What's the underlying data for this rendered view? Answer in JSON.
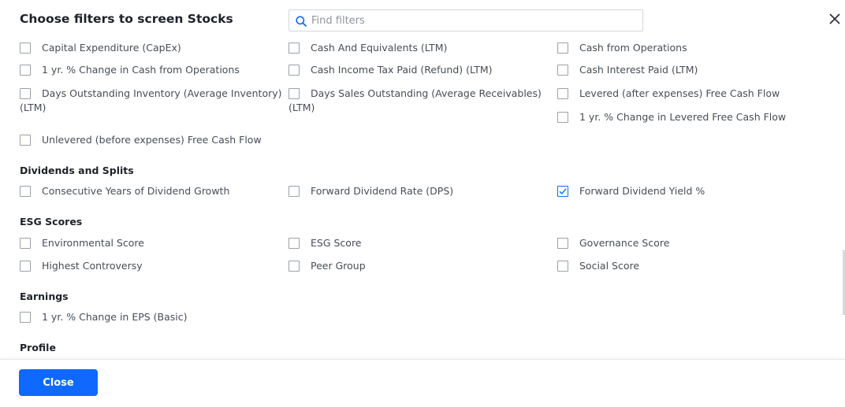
{
  "header": {
    "title": "Choose filters to screen Stocks",
    "search_placeholder": "Find filters",
    "close_icon": "close-icon"
  },
  "cash_flow": {
    "items": [
      {
        "label": "Capital Expenditure (CapEx)",
        "checked": false
      },
      {
        "label": "Cash And Equivalents (LTM)",
        "checked": false
      },
      {
        "label": "Cash from Operations",
        "checked": false
      },
      {
        "label": "1 yr. % Change in Cash from Operations",
        "checked": false
      },
      {
        "label": "Cash Income Tax Paid (Refund) (LTM)",
        "checked": false
      },
      {
        "label": "Cash Interest Paid (LTM)",
        "checked": false
      },
      {
        "label": "Days Outstanding Inventory (Average Inventory)",
        "label_cont": "(LTM)",
        "checked": false
      },
      {
        "label": "Days Sales Outstanding (Average Receivables)",
        "label_cont": "(LTM)",
        "checked": false
      },
      {
        "label": "Levered (after expenses) Free Cash Flow",
        "checked": false
      },
      {
        "label": "1 yr. % Change in Levered Free Cash Flow",
        "checked": false
      },
      {
        "label": "Unlevered (before expenses) Free Cash Flow",
        "checked": false
      }
    ]
  },
  "sections": [
    {
      "title": "Dividends and Splits",
      "items": [
        {
          "label": "Consecutive Years of Dividend Growth",
          "checked": false
        },
        {
          "label": "Forward Dividend Rate (DPS)",
          "checked": false
        },
        {
          "label": "Forward Dividend Yield %",
          "checked": true
        }
      ]
    },
    {
      "title": "ESG Scores",
      "items": [
        {
          "label": "Environmental Score",
          "checked": false
        },
        {
          "label": "ESG Score",
          "checked": false
        },
        {
          "label": "Governance Score",
          "checked": false
        },
        {
          "label": "Highest Controversy",
          "checked": false
        },
        {
          "label": "Peer Group",
          "checked": false
        },
        {
          "label": "Social Score",
          "checked": false
        }
      ]
    },
    {
      "title": "Earnings",
      "items": [
        {
          "label": "1 yr. % Change in EPS (Basic)",
          "checked": false
        }
      ]
    },
    {
      "title": "Profile",
      "items": []
    }
  ],
  "footer": {
    "close_label": "Close"
  },
  "colors": {
    "accent": "#0f69ff",
    "text": "#464e56",
    "heading": "#1d2228"
  }
}
